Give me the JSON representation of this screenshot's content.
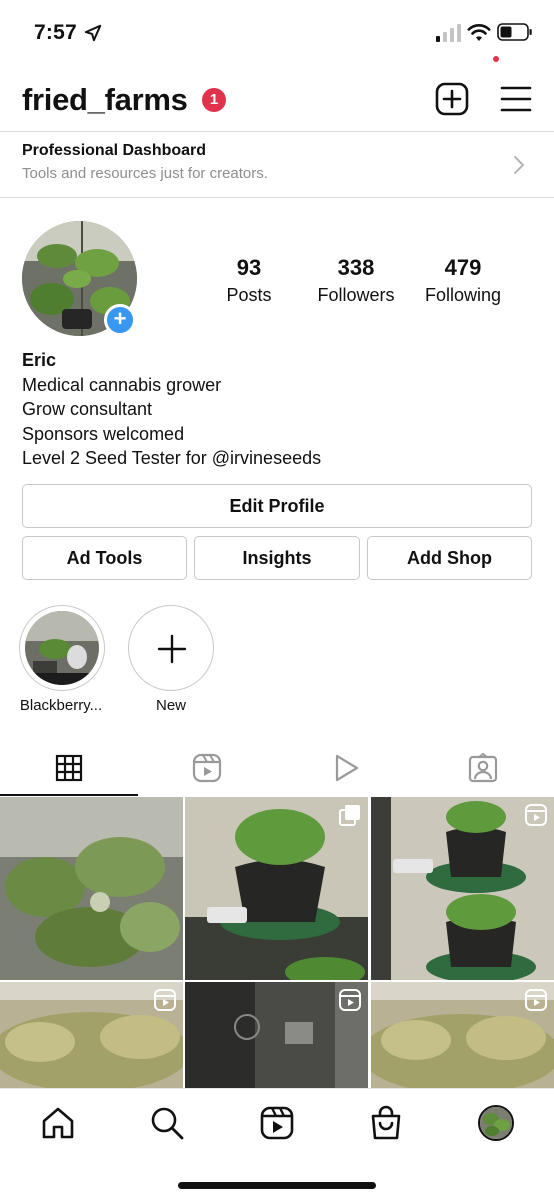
{
  "status_bar": {
    "time": "7:57",
    "icons": [
      "location-arrow-icon",
      "cellular-signal-icon",
      "wifi-icon",
      "battery-icon"
    ]
  },
  "header": {
    "username": "fried_farms",
    "notification_count": "1",
    "icons": [
      "new-post-icon",
      "menu-icon"
    ]
  },
  "dashboard": {
    "title": "Professional Dashboard",
    "subtitle": "Tools and resources just for creators.",
    "icon": "chevron-right-icon"
  },
  "profile": {
    "stats": [
      {
        "value": "93",
        "label": "Posts"
      },
      {
        "value": "338",
        "label": "Followers"
      },
      {
        "value": "479",
        "label": "Following"
      }
    ],
    "name": "Eric",
    "bio_lines": [
      "Medical cannabis grower",
      "Grow consultant",
      "Sponsors welcomed",
      "Level 2 Seed Tester for @irvineseeds"
    ]
  },
  "buttons": {
    "edit_profile": "Edit Profile",
    "ad_tools": "Ad Tools",
    "insights": "Insights",
    "add_shop": "Add Shop"
  },
  "highlights": [
    {
      "label": "Blackberry..."
    },
    {
      "label": "New"
    }
  ],
  "tabs": [
    "grid-icon",
    "reels-icon",
    "video-icon",
    "tagged-icon"
  ],
  "bottom_nav": [
    "home-icon",
    "search-icon",
    "reels-icon",
    "shop-icon",
    "profile-avatar"
  ],
  "colors": {
    "badge": "#e3324b",
    "accent_blue": "#3897f0",
    "muted_text": "#8e8e8e",
    "border": "#dbdbdb"
  }
}
